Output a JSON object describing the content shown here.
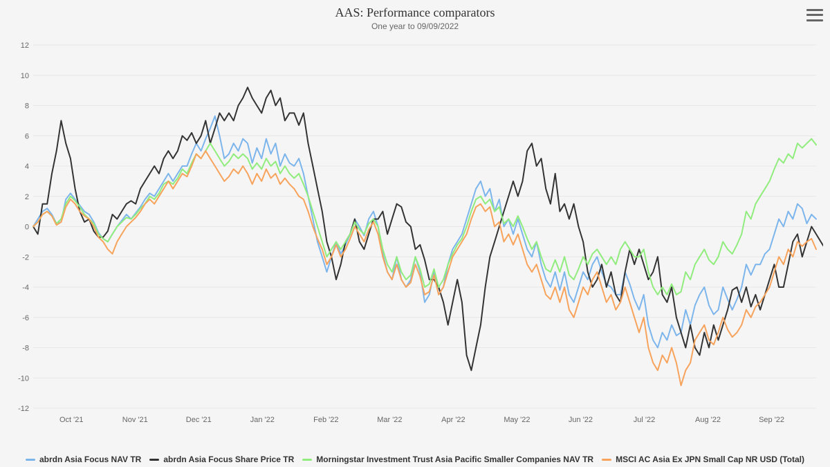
{
  "chart_data": {
    "type": "line",
    "title": "AAS: Performance comparators",
    "subtitle": "One year to 09/09/2022",
    "xlabel": "",
    "ylabel": "",
    "ylim": [
      -12,
      12
    ],
    "y_ticks": [
      -12,
      -10,
      -8,
      -6,
      -4,
      -2,
      0,
      2,
      4,
      6,
      8,
      10,
      12
    ],
    "x_ticks": [
      "Oct '21",
      "Nov '21",
      "Dec '21",
      "Jan '22",
      "Feb '22",
      "Mar '22",
      "Apr '22",
      "May '22",
      "Jun '22",
      "Jul '22",
      "Aug '22",
      "Sep '22"
    ],
    "series": [
      {
        "name": "abrdn Asia Focus NAV TR",
        "color": "#7cb5ec",
        "values": [
          0.0,
          0.5,
          1.0,
          1.2,
          0.8,
          0.2,
          0.3,
          1.8,
          2.2,
          1.8,
          1.4,
          1.0,
          0.8,
          0.3,
          -0.4,
          -0.8,
          -1.0,
          -0.5,
          0.0,
          0.4,
          0.8,
          0.5,
          0.9,
          1.3,
          1.8,
          2.2,
          2.0,
          2.5,
          3.0,
          3.5,
          3.0,
          3.5,
          4.0,
          4.0,
          4.8,
          5.5,
          5.0,
          5.8,
          6.5,
          7.3,
          6.0,
          4.5,
          4.8,
          5.5,
          5.0,
          5.8,
          5.5,
          4.2,
          5.2,
          4.5,
          5.8,
          4.8,
          5.5,
          4.0,
          4.8,
          4.2,
          4.0,
          4.5,
          3.5,
          2.0,
          0.5,
          -1.0,
          -2.0,
          -3.0,
          -2.0,
          -1.0,
          -1.8,
          -1.2,
          -0.5,
          0.5,
          0.0,
          -0.6,
          0.5,
          1.0,
          0.0,
          -1.8,
          -3.0,
          -3.5,
          -2.0,
          -3.5,
          -4.0,
          -3.5,
          -2.0,
          -3.0,
          -5.0,
          -4.5,
          -3.0,
          -4.5,
          -4.0,
          -2.5,
          -1.5,
          -1.0,
          -0.5,
          0.5,
          1.5,
          2.5,
          3.0,
          2.0,
          2.5,
          1.0,
          1.8,
          0.0,
          0.5,
          -0.5,
          0.5,
          -0.5,
          -1.5,
          -2.0,
          -1.0,
          -2.5,
          -3.5,
          -4.0,
          -3.0,
          -4.2,
          -3.0,
          -4.5,
          -5.0,
          -4.0,
          -3.0,
          -3.5,
          -2.5,
          -2.0,
          -3.0,
          -3.8,
          -4.0,
          -4.5,
          -4.5,
          -3.0,
          -3.8,
          -4.8,
          -5.5,
          -4.5,
          -6.5,
          -7.5,
          -8.0,
          -7.0,
          -7.5,
          -6.5,
          -7.2,
          -7.0,
          -5.5,
          -6.5,
          -5.2,
          -4.5,
          -4.0,
          -5.2,
          -5.8,
          -5.5,
          -4.0,
          -4.8,
          -5.5,
          -4.8,
          -4.0,
          -2.5,
          -3.2,
          -2.5,
          -2.5,
          -1.8,
          -1.5,
          -0.5,
          0.5,
          0.0,
          1.0,
          0.5,
          1.5,
          1.2,
          0.2,
          0.8,
          0.5
        ]
      },
      {
        "name": "abrdn Asia Focus Share Price TR",
        "color": "#333333",
        "values": [
          0.0,
          -0.5,
          1.5,
          1.5,
          3.5,
          5.0,
          7.0,
          5.5,
          4.5,
          2.5,
          1.0,
          0.3,
          0.5,
          -0.3,
          -0.7,
          -0.7,
          -0.3,
          0.8,
          0.5,
          1.0,
          1.5,
          1.7,
          1.5,
          2.5,
          3.0,
          3.5,
          4.0,
          3.5,
          4.5,
          5.0,
          4.5,
          5.0,
          6.0,
          5.7,
          6.2,
          5.5,
          6.0,
          7.0,
          5.5,
          6.5,
          7.5,
          7.0,
          7.5,
          7.0,
          8.0,
          8.5,
          9.2,
          8.5,
          8.0,
          7.5,
          8.5,
          9.0,
          8.0,
          8.5,
          7.0,
          7.5,
          7.5,
          6.7,
          7.5,
          5.5,
          4.0,
          2.5,
          1.0,
          -1.0,
          -2.0,
          -3.5,
          -2.5,
          -1.0,
          -0.5,
          0.5,
          -1.0,
          -1.5,
          -0.5,
          0.5,
          0.5,
          1.0,
          -0.5,
          0.5,
          1.5,
          1.3,
          0.3,
          0.0,
          -1.5,
          -1.2,
          -2.2,
          -3.5,
          -3.5,
          -4.0,
          -5.0,
          -6.5,
          -5.0,
          -3.5,
          -5.0,
          -8.5,
          -9.5,
          -8.0,
          -6.5,
          -4.0,
          -2.0,
          -1.0,
          0.0,
          1.0,
          2.0,
          3.0,
          2.0,
          3.0,
          5.0,
          5.5,
          4.0,
          4.5,
          2.5,
          1.5,
          3.5,
          1.0,
          1.5,
          0.5,
          1.5,
          0.0,
          -1.0,
          -3.0,
          -4.0,
          -3.5,
          -2.5,
          -4.0,
          -3.0,
          -4.5,
          -5.0,
          -3.0,
          -1.5,
          -2.5,
          -1.5,
          -2.5,
          -3.5,
          -3.0,
          -2.0,
          -4.5,
          -5.0,
          -4.0,
          -6.0,
          -7.0,
          -8.0,
          -6.5,
          -8.0,
          -8.5,
          -7.0,
          -8.0,
          -6.5,
          -7.5,
          -6.5,
          -5.5,
          -4.2,
          -4.0,
          -5.0,
          -4.0,
          -5.3,
          -4.5,
          -5.5,
          -4.5,
          -3.5,
          -2.5,
          -4.0,
          -4.0,
          -2.5,
          -1.0,
          -0.5,
          -2.0,
          -1.0,
          0.0,
          -0.5,
          -1.0,
          -1.5
        ]
      },
      {
        "name": "Morningstar Investment Trust Asia Pacific Smaller Companies NAV TR",
        "color": "#90ed7d",
        "values": [
          0.0,
          0.3,
          0.8,
          1.0,
          0.7,
          0.2,
          0.5,
          1.5,
          2.0,
          1.7,
          1.3,
          0.8,
          0.5,
          0.2,
          -0.5,
          -0.8,
          -1.0,
          -0.5,
          0.0,
          0.3,
          0.6,
          0.5,
          0.8,
          1.2,
          1.5,
          2.0,
          1.8,
          2.2,
          2.8,
          3.0,
          2.8,
          3.2,
          3.8,
          3.5,
          4.2,
          4.8,
          4.5,
          5.0,
          5.5,
          5.0,
          4.5,
          4.0,
          4.3,
          4.8,
          4.5,
          4.8,
          4.5,
          3.8,
          4.2,
          3.8,
          4.5,
          4.0,
          4.3,
          3.5,
          4.0,
          3.5,
          3.2,
          3.5,
          2.8,
          2.0,
          1.0,
          0.0,
          -1.0,
          -2.0,
          -1.5,
          -1.0,
          -1.5,
          -1.0,
          -0.5,
          0.3,
          -0.2,
          -0.5,
          0.2,
          0.5,
          0.0,
          -1.5,
          -2.5,
          -3.0,
          -2.0,
          -3.0,
          -3.5,
          -3.2,
          -2.0,
          -2.8,
          -4.0,
          -3.8,
          -2.8,
          -4.0,
          -3.5,
          -2.5,
          -1.8,
          -1.2,
          -0.8,
          0.0,
          1.0,
          1.8,
          2.0,
          1.5,
          1.8,
          1.0,
          1.3,
          0.2,
          0.5,
          0.0,
          0.7,
          0.0,
          -0.8,
          -1.5,
          -1.0,
          -2.0,
          -2.8,
          -3.0,
          -2.2,
          -3.0,
          -2.0,
          -3.2,
          -3.5,
          -2.8,
          -2.0,
          -2.5,
          -1.8,
          -1.5,
          -2.0,
          -2.5,
          -2.0,
          -2.5,
          -1.5,
          -1.0,
          -1.5,
          -2.0,
          -2.0,
          -1.5,
          -3.0,
          -4.0,
          -4.5,
          -4.0,
          -4.5,
          -3.8,
          -4.5,
          -4.3,
          -3.0,
          -3.5,
          -2.5,
          -2.0,
          -1.5,
          -2.2,
          -2.5,
          -2.0,
          -1.0,
          -1.5,
          -1.8,
          -1.2,
          -0.5,
          1.0,
          0.5,
          1.5,
          2.0,
          2.5,
          3.0,
          3.8,
          4.5,
          4.2,
          4.8,
          4.5,
          5.5,
          5.2,
          5.5,
          5.8,
          5.4
        ]
      },
      {
        "name": "MSCI AC Asia Ex JPN Small Cap NR USD (Total)",
        "color": "#f7a35c",
        "values": [
          0.0,
          0.3,
          0.8,
          1.0,
          0.7,
          0.1,
          0.3,
          1.3,
          1.8,
          1.5,
          1.0,
          0.7,
          0.5,
          0.0,
          -0.7,
          -1.0,
          -1.5,
          -1.8,
          -1.0,
          -0.5,
          0.0,
          0.3,
          0.6,
          1.0,
          1.5,
          1.8,
          1.5,
          2.0,
          2.5,
          3.0,
          2.5,
          3.0,
          3.5,
          3.3,
          4.0,
          4.8,
          4.5,
          5.0,
          4.5,
          4.0,
          3.5,
          3.0,
          3.3,
          3.8,
          3.5,
          4.0,
          3.5,
          2.8,
          3.5,
          3.0,
          3.8,
          3.2,
          3.5,
          2.8,
          3.2,
          2.8,
          2.5,
          2.0,
          1.8,
          1.0,
          0.0,
          -0.8,
          -1.5,
          -2.5,
          -2.0,
          -1.2,
          -2.0,
          -1.5,
          -0.8,
          0.0,
          -0.5,
          -1.0,
          -0.2,
          0.3,
          -0.5,
          -2.0,
          -3.0,
          -3.5,
          -2.5,
          -3.5,
          -4.0,
          -3.7,
          -2.5,
          -3.3,
          -4.5,
          -4.3,
          -3.2,
          -4.5,
          -4.0,
          -3.0,
          -2.0,
          -1.5,
          -1.0,
          -0.5,
          0.5,
          1.3,
          1.5,
          1.0,
          1.3,
          0.0,
          0.3,
          -1.0,
          -0.5,
          -1.2,
          -0.5,
          -1.5,
          -2.5,
          -3.0,
          -2.5,
          -3.5,
          -4.5,
          -4.8,
          -4.0,
          -5.0,
          -4.0,
          -5.5,
          -6.0,
          -5.0,
          -4.0,
          -4.5,
          -3.5,
          -3.0,
          -4.0,
          -5.0,
          -4.5,
          -5.5,
          -5.0,
          -4.0,
          -5.0,
          -6.0,
          -7.0,
          -6.0,
          -8.0,
          -9.0,
          -9.5,
          -8.5,
          -9.0,
          -8.0,
          -9.0,
          -10.5,
          -9.5,
          -9.0,
          -7.5,
          -7.0,
          -6.5,
          -7.5,
          -7.8,
          -7.0,
          -6.0,
          -6.8,
          -7.3,
          -7.0,
          -6.5,
          -5.5,
          -6.0,
          -5.3,
          -5.0,
          -4.5,
          -4.0,
          -3.0,
          -2.0,
          -2.5,
          -1.5,
          -2.0,
          -1.0,
          -1.3,
          -1.0,
          -0.8,
          -1.5
        ]
      }
    ]
  },
  "menu": {
    "label": "Chart context menu"
  }
}
